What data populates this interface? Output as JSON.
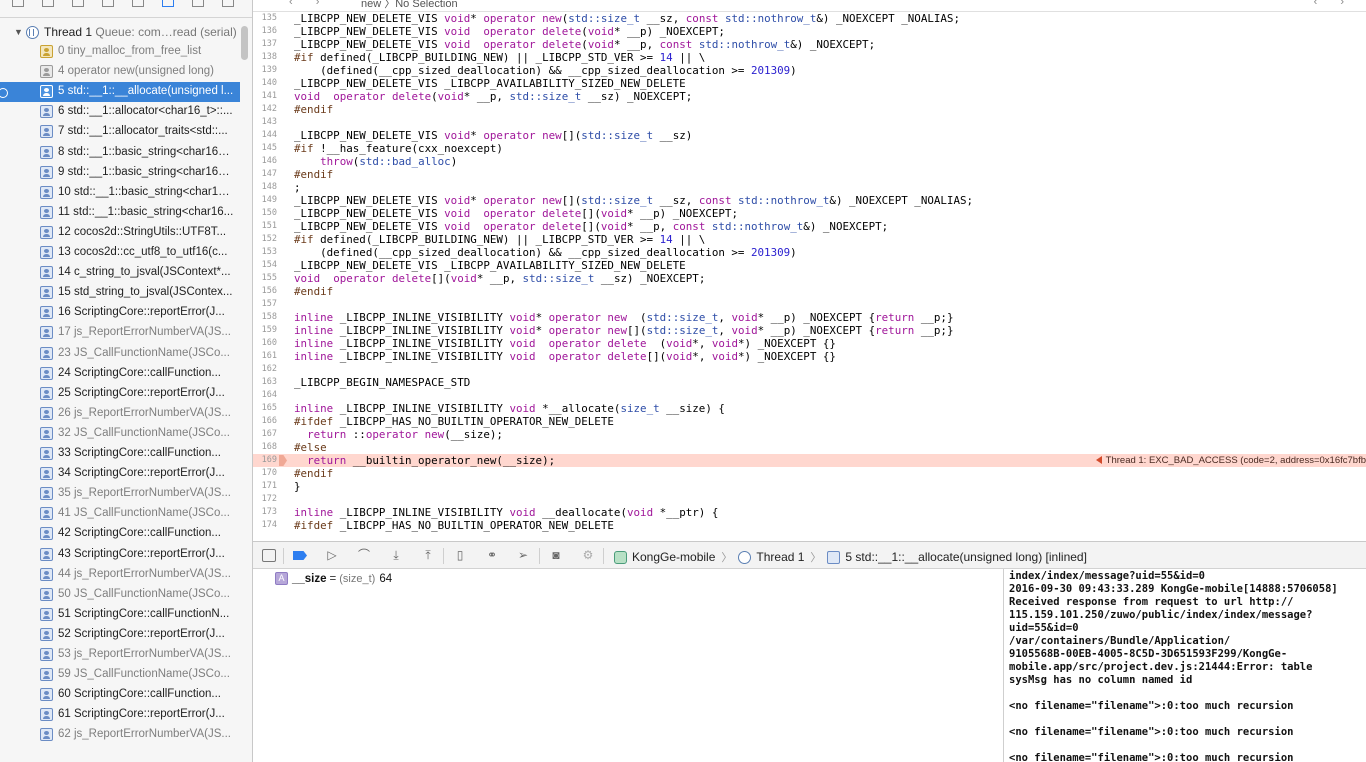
{
  "navigator": {
    "thread_title": "Thread 1",
    "thread_queue": " Queue: com…read (serial)",
    "frames": [
      {
        "label": "0 tiny_malloc_from_free_list",
        "kind": "lib",
        "dim": true,
        "selected": false
      },
      {
        "label": "4 operator new(unsigned long)",
        "kind": "sys",
        "dim": true,
        "selected": false
      },
      {
        "label": "5 std::__1::__allocate(unsigned l...",
        "kind": "user",
        "dim": false,
        "selected": true
      },
      {
        "label": "6 std::__1::allocator<char16_t>::...",
        "kind": "user",
        "dim": false,
        "selected": false
      },
      {
        "label": "7 std::__1::allocator_traits<std::...",
        "kind": "user",
        "dim": false,
        "selected": false
      },
      {
        "label": "8 std::__1::basic_string<char16_...",
        "kind": "user",
        "dim": false,
        "selected": false
      },
      {
        "label": "9 std::__1::basic_string<char16_...",
        "kind": "user",
        "dim": false,
        "selected": false
      },
      {
        "label": "10 std::__1::basic_string<char16...",
        "kind": "user",
        "dim": false,
        "selected": false
      },
      {
        "label": "11 std::__1::basic_string<char16...",
        "kind": "user",
        "dim": false,
        "selected": false
      },
      {
        "label": "12 cocos2d::StringUtils::UTF8T...",
        "kind": "user",
        "dim": false,
        "selected": false
      },
      {
        "label": "13 cocos2d::cc_utf8_to_utf16(c...",
        "kind": "user",
        "dim": false,
        "selected": false
      },
      {
        "label": "14 c_string_to_jsval(JSContext*...",
        "kind": "user",
        "dim": false,
        "selected": false
      },
      {
        "label": "15 std_string_to_jsval(JSContex...",
        "kind": "user",
        "dim": false,
        "selected": false
      },
      {
        "label": "16 ScriptingCore::reportError(J...",
        "kind": "user",
        "dim": false,
        "selected": false
      },
      {
        "label": "17 js_ReportErrorNumberVA(JS...",
        "kind": "user",
        "dim": true,
        "selected": false
      },
      {
        "label": "23 JS_CallFunctionName(JSCo...",
        "kind": "user",
        "dim": true,
        "selected": false
      },
      {
        "label": "24 ScriptingCore::callFunction...",
        "kind": "user",
        "dim": false,
        "selected": false
      },
      {
        "label": "25 ScriptingCore::reportError(J...",
        "kind": "user",
        "dim": false,
        "selected": false
      },
      {
        "label": "26 js_ReportErrorNumberVA(JS...",
        "kind": "user",
        "dim": true,
        "selected": false
      },
      {
        "label": "32 JS_CallFunctionName(JSCo...",
        "kind": "user",
        "dim": true,
        "selected": false
      },
      {
        "label": "33 ScriptingCore::callFunction...",
        "kind": "user",
        "dim": false,
        "selected": false
      },
      {
        "label": "34 ScriptingCore::reportError(J...",
        "kind": "user",
        "dim": false,
        "selected": false
      },
      {
        "label": "35 js_ReportErrorNumberVA(JS...",
        "kind": "user",
        "dim": true,
        "selected": false
      },
      {
        "label": "41 JS_CallFunctionName(JSCo...",
        "kind": "user",
        "dim": true,
        "selected": false
      },
      {
        "label": "42 ScriptingCore::callFunction...",
        "kind": "user",
        "dim": false,
        "selected": false
      },
      {
        "label": "43 ScriptingCore::reportError(J...",
        "kind": "user",
        "dim": false,
        "selected": false
      },
      {
        "label": "44 js_ReportErrorNumberVA(JS...",
        "kind": "user",
        "dim": true,
        "selected": false
      },
      {
        "label": "50 JS_CallFunctionName(JSCo...",
        "kind": "user",
        "dim": true,
        "selected": false
      },
      {
        "label": "51 ScriptingCore::callFunctionN...",
        "kind": "user",
        "dim": false,
        "selected": false
      },
      {
        "label": "52 ScriptingCore::reportError(J...",
        "kind": "user",
        "dim": false,
        "selected": false
      },
      {
        "label": "53 js_ReportErrorNumberVA(JS...",
        "kind": "user",
        "dim": true,
        "selected": false
      },
      {
        "label": "59 JS_CallFunctionName(JSCo...",
        "kind": "user",
        "dim": true,
        "selected": false
      },
      {
        "label": "60 ScriptingCore::callFunction...",
        "kind": "user",
        "dim": false,
        "selected": false
      },
      {
        "label": "61 ScriptingCore::reportError(J...",
        "kind": "user",
        "dim": false,
        "selected": false
      },
      {
        "label": "62 js_ReportErrorNumberVA(JS...",
        "kind": "user",
        "dim": true,
        "selected": false
      }
    ]
  },
  "editor": {
    "breadcrumb": "new 〉No Selection",
    "error_line": 169,
    "error_message": "Thread 1: EXC_BAD_ACCESS (code=2, address=0x16fc7bfb",
    "lines": [
      {
        "n": 135,
        "t": "_LIBCPP_NEW_DELETE_VIS void* operator new(std::size_t __sz, const std::nothrow_t&) _NOEXCEPT _NOALIAS;"
      },
      {
        "n": 136,
        "t": "_LIBCPP_NEW_DELETE_VIS void  operator delete(void* __p) _NOEXCEPT;"
      },
      {
        "n": 137,
        "t": "_LIBCPP_NEW_DELETE_VIS void  operator delete(void* __p, const std::nothrow_t&) _NOEXCEPT;"
      },
      {
        "n": 138,
        "t": "#if defined(_LIBCPP_BUILDING_NEW) || _LIBCPP_STD_VER >= 14 || \\"
      },
      {
        "n": 139,
        "t": "    (defined(__cpp_sized_deallocation) && __cpp_sized_deallocation >= 201309)"
      },
      {
        "n": 140,
        "t": "_LIBCPP_NEW_DELETE_VIS _LIBCPP_AVAILABILITY_SIZED_NEW_DELETE"
      },
      {
        "n": 141,
        "t": "void  operator delete(void* __p, std::size_t __sz) _NOEXCEPT;"
      },
      {
        "n": 142,
        "t": "#endif"
      },
      {
        "n": 143,
        "t": ""
      },
      {
        "n": 144,
        "t": "_LIBCPP_NEW_DELETE_VIS void* operator new[](std::size_t __sz)"
      },
      {
        "n": 145,
        "t": "#if !__has_feature(cxx_noexcept)"
      },
      {
        "n": 146,
        "t": "    throw(std::bad_alloc)"
      },
      {
        "n": 147,
        "t": "#endif"
      },
      {
        "n": 148,
        "t": ";"
      },
      {
        "n": 149,
        "t": "_LIBCPP_NEW_DELETE_VIS void* operator new[](std::size_t __sz, const std::nothrow_t&) _NOEXCEPT _NOALIAS;"
      },
      {
        "n": 150,
        "t": "_LIBCPP_NEW_DELETE_VIS void  operator delete[](void* __p) _NOEXCEPT;"
      },
      {
        "n": 151,
        "t": "_LIBCPP_NEW_DELETE_VIS void  operator delete[](void* __p, const std::nothrow_t&) _NOEXCEPT;"
      },
      {
        "n": 152,
        "t": "#if defined(_LIBCPP_BUILDING_NEW) || _LIBCPP_STD_VER >= 14 || \\"
      },
      {
        "n": 153,
        "t": "    (defined(__cpp_sized_deallocation) && __cpp_sized_deallocation >= 201309)"
      },
      {
        "n": 154,
        "t": "_LIBCPP_NEW_DELETE_VIS _LIBCPP_AVAILABILITY_SIZED_NEW_DELETE"
      },
      {
        "n": 155,
        "t": "void  operator delete[](void* __p, std::size_t __sz) _NOEXCEPT;"
      },
      {
        "n": 156,
        "t": "#endif"
      },
      {
        "n": 157,
        "t": ""
      },
      {
        "n": 158,
        "t": "inline _LIBCPP_INLINE_VISIBILITY void* operator new  (std::size_t, void* __p) _NOEXCEPT {return __p;}"
      },
      {
        "n": 159,
        "t": "inline _LIBCPP_INLINE_VISIBILITY void* operator new[](std::size_t, void* __p) _NOEXCEPT {return __p;}"
      },
      {
        "n": 160,
        "t": "inline _LIBCPP_INLINE_VISIBILITY void  operator delete  (void*, void*) _NOEXCEPT {}"
      },
      {
        "n": 161,
        "t": "inline _LIBCPP_INLINE_VISIBILITY void  operator delete[](void*, void*) _NOEXCEPT {}"
      },
      {
        "n": 162,
        "t": ""
      },
      {
        "n": 163,
        "t": "_LIBCPP_BEGIN_NAMESPACE_STD"
      },
      {
        "n": 164,
        "t": ""
      },
      {
        "n": 165,
        "t": "inline _LIBCPP_INLINE_VISIBILITY void *__allocate(size_t __size) {"
      },
      {
        "n": 166,
        "t": "#ifdef _LIBCPP_HAS_NO_BUILTIN_OPERATOR_NEW_DELETE"
      },
      {
        "n": 167,
        "t": "  return ::operator new(__size);"
      },
      {
        "n": 168,
        "t": "#else"
      },
      {
        "n": 169,
        "t": "  return __builtin_operator_new(__size);"
      },
      {
        "n": 170,
        "t": "#endif"
      },
      {
        "n": 171,
        "t": "}"
      },
      {
        "n": 172,
        "t": ""
      },
      {
        "n": 173,
        "t": "inline _LIBCPP_INLINE_VISIBILITY void __deallocate(void *__ptr) {"
      },
      {
        "n": 174,
        "t": "#ifdef _LIBCPP_HAS_NO_BUILTIN_OPERATOR_NEW_DELETE"
      }
    ]
  },
  "debugbar": {
    "app": "KongGe-mobile",
    "thread": "Thread 1",
    "frame": "5 std::__1::__allocate(unsigned long) [inlined]"
  },
  "variables": {
    "kind_badge": "A",
    "name": "__size",
    "eq": "=",
    "type": "(size_t)",
    "value": "64"
  },
  "console": {
    "lines": [
      "index/index/message?uid=55&id=0",
      "2016-09-30 09:43:33.289 KongGe-mobile[14888:5706058]",
      "Received response from request to url http://",
      "115.159.101.250/zuwo/public/index/index/message?",
      "uid=55&id=0",
      "/var/containers/Bundle/Application/",
      "9105568B-00EB-4005-8C5D-3D651593F299/KongGe-",
      "mobile.app/src/project.dev.js:21444:Error: table",
      "sysMsg has no column named id",
      "",
      "<no filename=\"filename\">:0:too much recursion",
      "",
      "<no filename=\"filename\">:0:too much recursion",
      "",
      "<no filename=\"filename\">:0:too much recursion"
    ]
  }
}
